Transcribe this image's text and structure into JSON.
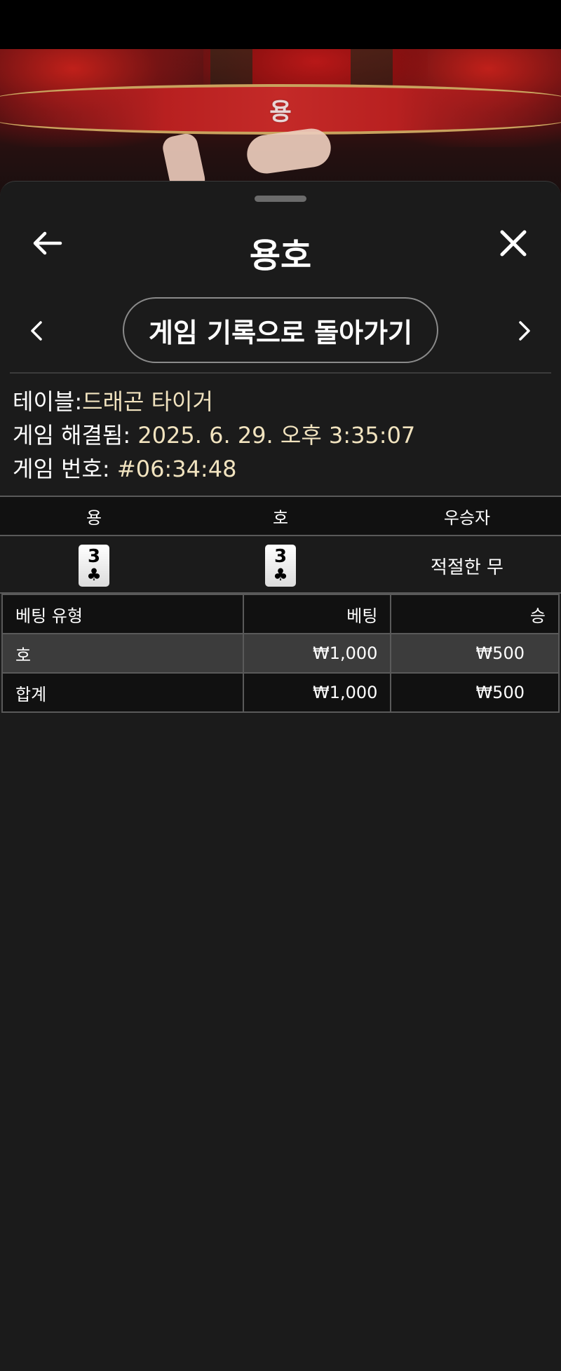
{
  "video": {
    "banner_label": "용"
  },
  "header": {
    "title": "용호"
  },
  "nav": {
    "history_button": "게임 기록으로 돌아가기"
  },
  "info": {
    "table_label": "테이블:",
    "table_value": "드래곤 타이거",
    "resolved_label": "게임 해결됨:",
    "resolved_value": "2025. 6. 29. 오후 3:35:07",
    "game_no_label": "게임 번호:",
    "game_no_value": "#06:34:48"
  },
  "result": {
    "headers": {
      "dragon": "용",
      "tiger": "호",
      "winner": "우승자"
    },
    "dragon_card": {
      "rank": "3",
      "suit": "♣"
    },
    "tiger_card": {
      "rank": "3",
      "suit": "♣"
    },
    "winner": "적절한 무"
  },
  "bets": {
    "headers": {
      "type": "베팅 유형",
      "bet": "베팅",
      "win": "승"
    },
    "rows": [
      {
        "type": "호",
        "bet": "₩1,000",
        "win": "₩500"
      }
    ],
    "total": {
      "type": "합계",
      "bet": "₩1,000",
      "win": "₩500"
    }
  }
}
